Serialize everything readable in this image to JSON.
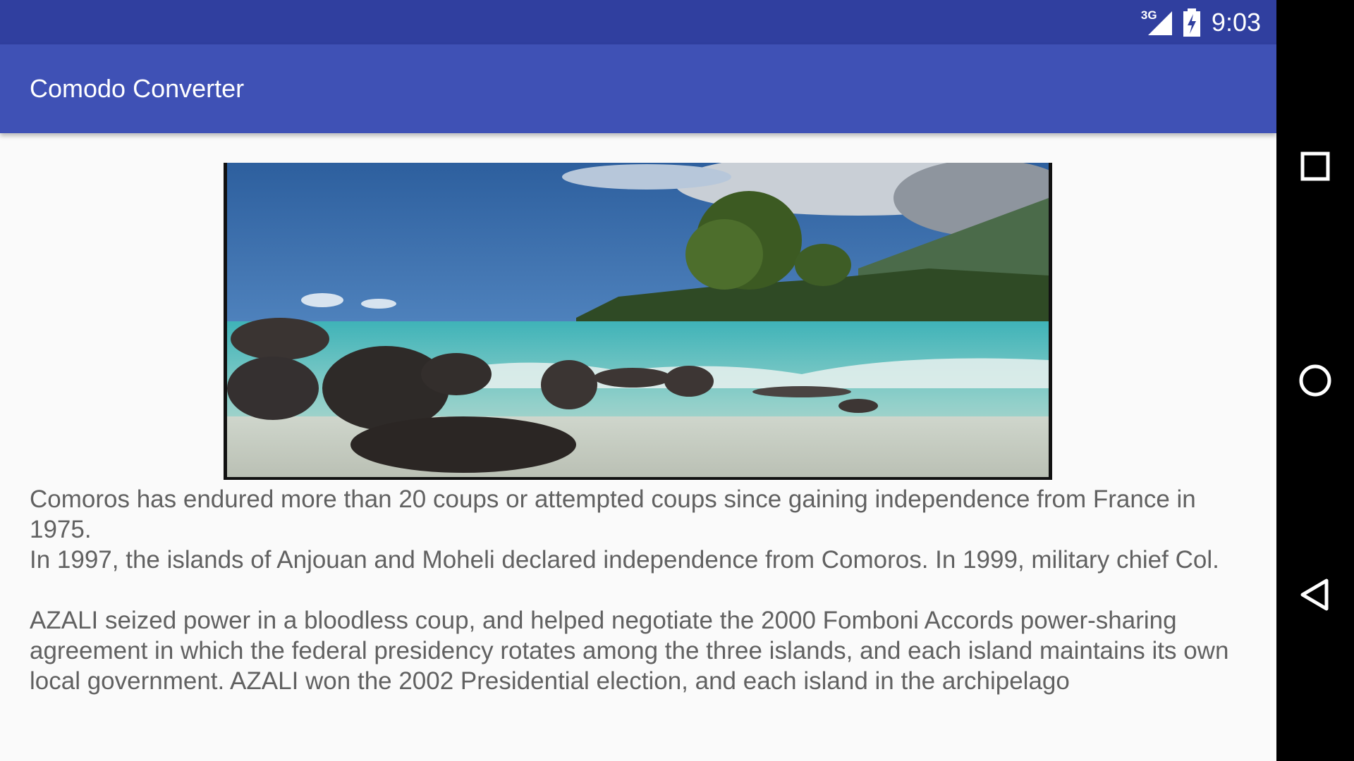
{
  "status_bar": {
    "network": "3G",
    "time": "9:03",
    "icons": [
      "signal-icon",
      "battery-charging-icon"
    ]
  },
  "app_bar": {
    "title": "Comodo Converter"
  },
  "hero_image": {
    "alt": "beach-rocks-island-photo"
  },
  "body": {
    "text": "Comoros has endured more than 20 coups or attempted coups since gaining independence from France in 1975.\n In 1997, the islands of Anjouan and Moheli declared independence from Comoros. In 1999, military chief Col.\n\n AZALI seized power in a bloodless coup, and helped negotiate the 2000 Fomboni Accords power-sharing agreement in which the federal presidency rotates among the three islands, and each island maintains its own local government. AZALI won the 2002 Presidential election, and each island in the archipelago"
  },
  "nav_bar": {
    "buttons": [
      "recents-button",
      "home-button",
      "back-button"
    ]
  },
  "colors": {
    "status_bar": "#303f9f",
    "app_bar": "#3f51b5",
    "background": "#fafafa",
    "text": "#616161"
  }
}
